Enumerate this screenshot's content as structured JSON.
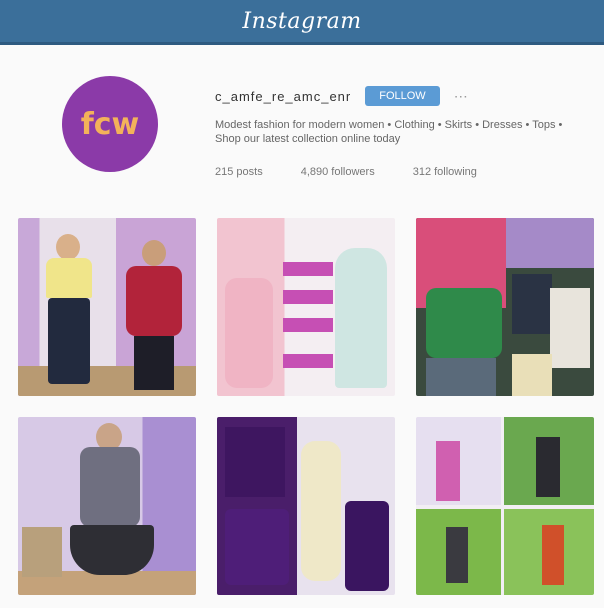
{
  "app": {
    "logo_text": "Instagram"
  },
  "profile": {
    "avatar_text": "fcw",
    "username": "c_amfe_re_amc_enr",
    "follow_label": "FOLLOW",
    "bio": "Modest fashion for modern women • Clothing • Skirts • Dresses • Tops • Shop our latest collection online today",
    "stats": {
      "posts": "215 posts",
      "followers": "4,890 followers",
      "following": "312 following"
    }
  },
  "colors": {
    "topbar": "#3b6f9a",
    "avatar_bg": "#8b3aa8",
    "avatar_text": "#f3b25a",
    "follow_button": "#5b9bd5"
  },
  "icons": {
    "more": "ellipsis-icon"
  }
}
